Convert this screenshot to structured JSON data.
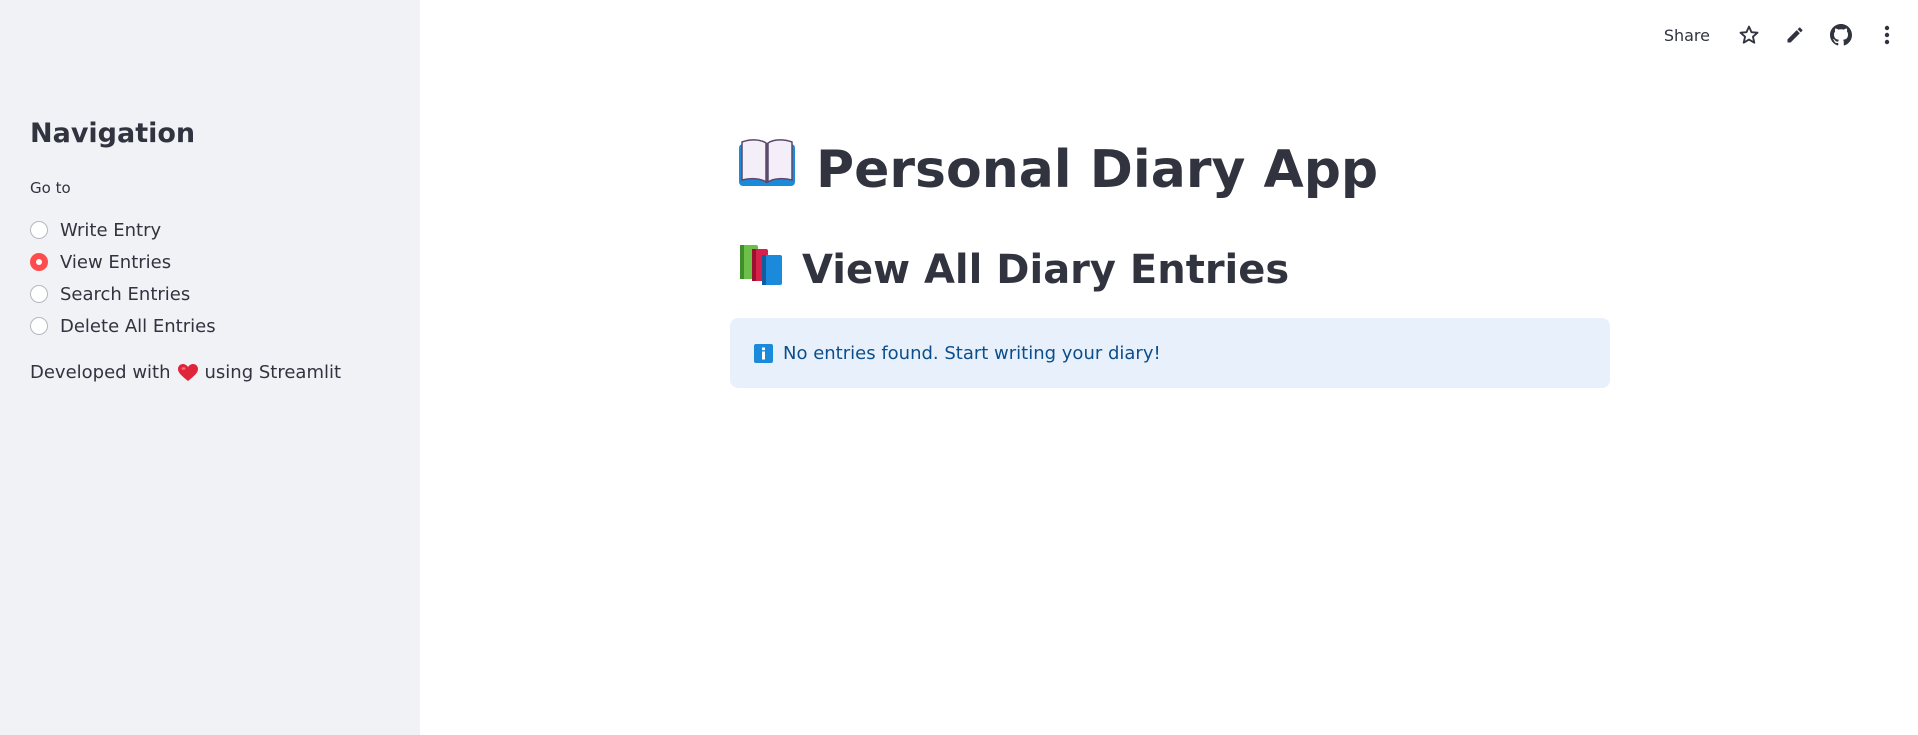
{
  "colors": {
    "sidebar_bg": "#F0F2F6",
    "accent": "#FF4B4B",
    "info_bg": "#E8F1FB",
    "info_text": "#0B4E8B",
    "text": "#31333F"
  },
  "sidebar": {
    "title": "Navigation",
    "goto_label": "Go to",
    "options": [
      {
        "label": "Write Entry",
        "selected": false
      },
      {
        "label": "View Entries",
        "selected": true
      },
      {
        "label": "Search Entries",
        "selected": false
      },
      {
        "label": "Delete All Entries",
        "selected": false
      }
    ],
    "footer_prefix": "Developed with",
    "footer_icon": "heart-icon",
    "footer_suffix": "using Streamlit"
  },
  "toolbar": {
    "share_label": "Share",
    "icons": [
      "star-icon",
      "pencil-icon",
      "github-icon",
      "more-vertical-icon"
    ]
  },
  "main": {
    "title_icon": "open-book-icon",
    "title": "Personal Diary App",
    "subtitle_icon": "books-icon",
    "subtitle": "View All Diary Entries",
    "info_icon": "info-icon",
    "info_message": "No entries found. Start writing your diary!"
  }
}
